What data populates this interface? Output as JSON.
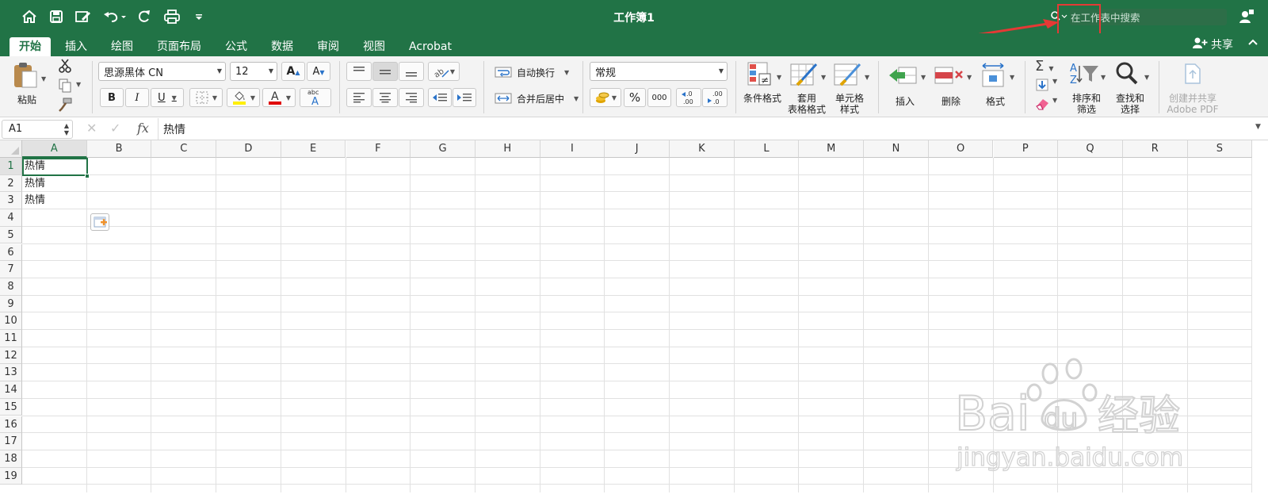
{
  "titlebar": {
    "doc_title": "工作簿1",
    "search_placeholder": "在工作表中搜索",
    "accent_color": "#217346",
    "highlight_color": "#e53935"
  },
  "tabs": [
    {
      "label": "开始",
      "active": true
    },
    {
      "label": "插入"
    },
    {
      "label": "绘图"
    },
    {
      "label": "页面布局"
    },
    {
      "label": "公式"
    },
    {
      "label": "数据"
    },
    {
      "label": "审阅"
    },
    {
      "label": "视图"
    },
    {
      "label": "Acrobat"
    }
  ],
  "share_label": "共享",
  "ribbon": {
    "paste_label": "粘贴",
    "font_name": "思源黑体 CN",
    "font_size": "12",
    "bold": "B",
    "italic": "I",
    "underline": "U",
    "wrap_text": "自动换行",
    "merge_center": "合并后居中",
    "number_format": "常规",
    "percent": "%",
    "thousands": "000",
    "cond_format": "条件格式",
    "format_table_1": "套用",
    "format_table_2": "表格格式",
    "cell_style_1": "单元格",
    "cell_style_2": "样式",
    "insert": "插入",
    "delete": "删除",
    "format": "格式",
    "sort_filter_1": "排序和",
    "sort_filter_2": "筛选",
    "find_select_1": "查找和",
    "find_select_2": "选择",
    "create_pdf_1": "创建并共享",
    "create_pdf_2": "Adobe PDF"
  },
  "formula_bar": {
    "name_box": "A1",
    "fx": "fx",
    "content": "热情"
  },
  "grid": {
    "columns": [
      "A",
      "B",
      "C",
      "D",
      "E",
      "F",
      "G",
      "H",
      "I",
      "J",
      "K",
      "L",
      "M",
      "N",
      "O",
      "P",
      "Q",
      "R",
      "S"
    ],
    "rows": [
      "1",
      "2",
      "3",
      "4",
      "5",
      "6",
      "7",
      "8",
      "9",
      "10",
      "11",
      "12",
      "13",
      "14",
      "15",
      "16",
      "17",
      "18",
      "19"
    ],
    "cells": {
      "A1": "热情",
      "A2": "热情",
      "A3": "热情"
    }
  },
  "watermark": {
    "line1": "Bai",
    "line2": "du",
    "line3": "经验",
    "url": "jingyan.baidu.com"
  }
}
